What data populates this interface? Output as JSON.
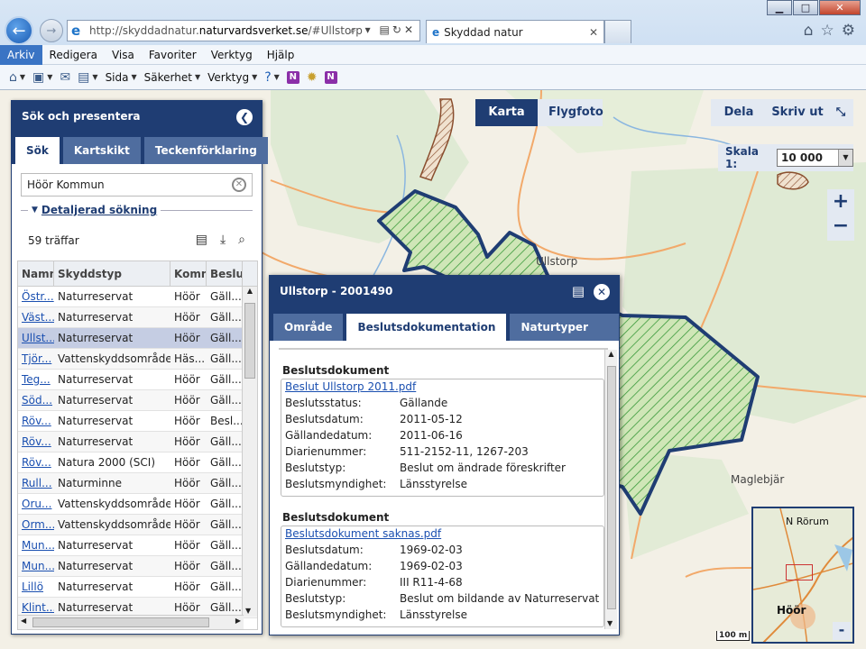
{
  "browser": {
    "url_prefix": "http://skyddadnatur.",
    "url_domain": "naturvardsverket.se",
    "url_suffix": "/#Ullstorp",
    "tab_title": "Skyddad natur",
    "menu": [
      "Arkiv",
      "Redigera",
      "Visa",
      "Favoriter",
      "Verktyg",
      "Hjälp"
    ],
    "commands": {
      "page": "Sida",
      "security": "Säkerhet",
      "tools": "Verktyg"
    }
  },
  "map": {
    "karta": "Karta",
    "flygfoto": "Flygfoto",
    "dela": "Dela",
    "skriv_ut": "Skriv ut",
    "scale_label": "Skala 1:",
    "scale_value": "10 000",
    "zoom_in": "+",
    "zoom_out": "−",
    "place_ullstorp": "Ullstorp",
    "place_maglebjar": "Maglebjär",
    "minimap_north": "N Rörum",
    "minimap_hoor": "Höör",
    "minimap_minus": "-",
    "scalebar": "100 m"
  },
  "panel": {
    "title": "Sök och presentera",
    "tabs": [
      "Sök",
      "Kartskikt",
      "Teckenförklaring"
    ],
    "search_value": "Höör Kommun",
    "advanced": "Detaljerad sökning",
    "hits": "59 träffar",
    "columns": [
      "Namn",
      "Skyddstyp",
      "Kommun",
      "Beslut"
    ],
    "rows": [
      [
        "Östr...",
        "Naturreservat",
        "Höör",
        "Gäll..."
      ],
      [
        "Väst...",
        "Naturreservat",
        "Höör",
        "Gäll..."
      ],
      [
        "Ullst...",
        "Naturreservat",
        "Höör",
        "Gäll..."
      ],
      [
        "Tjör...",
        "Vattenskyddsområde",
        "Häs...",
        "Gäll..."
      ],
      [
        "Teg...",
        "Naturreservat",
        "Höör",
        "Gäll..."
      ],
      [
        "Söd...",
        "Naturreservat",
        "Höör",
        "Gäll..."
      ],
      [
        "Röv...",
        "Naturreservat",
        "Höör",
        "Besl..."
      ],
      [
        "Röv...",
        "Naturreservat",
        "Höör",
        "Gäll..."
      ],
      [
        "Röv...",
        "Natura 2000 (SCI)",
        "Höör",
        "Gäll..."
      ],
      [
        "Rull...",
        "Naturminne",
        "Höör",
        "Gäll..."
      ],
      [
        "Oru...",
        "Vattenskyddsområde",
        "Höör",
        "Gäll..."
      ],
      [
        "Orm...",
        "Vattenskyddsområde",
        "Höör",
        "Gäll..."
      ],
      [
        "Mun...",
        "Naturreservat",
        "Höör",
        "Gäll..."
      ],
      [
        "Mun...",
        "Naturreservat",
        "Höör",
        "Gäll..."
      ],
      [
        "Lillö",
        "Naturreservat",
        "Höör",
        "Gäll..."
      ],
      [
        "Klint...",
        "Naturreservat",
        "Höör",
        "Gäll..."
      ]
    ],
    "selected_row": 2
  },
  "popup": {
    "title": "Ullstorp - 2001490",
    "tabs": [
      "Område",
      "Beslutsdokumentation",
      "Naturtyper (KNAS)"
    ],
    "docs": [
      {
        "heading": "Beslutsdokument",
        "link": "Beslut Ullstorp 2011.pdf",
        "fields": [
          [
            "Beslutsstatus:",
            "Gällande"
          ],
          [
            "Beslutsdatum:",
            "2011-05-12"
          ],
          [
            "Gällandedatum:",
            "2011-06-16"
          ],
          [
            "Diarienummer:",
            "511-2152-11, 1267-203"
          ],
          [
            "Beslutstyp:",
            "Beslut om ändrade föreskrifter"
          ],
          [
            "Beslutsmyndighet:",
            "Länsstyrelse"
          ]
        ]
      },
      {
        "heading": "Beslutsdokument",
        "link": "Beslutsdokument saknas.pdf",
        "fields": [
          [
            "Beslutsdatum:",
            "1969-02-03"
          ],
          [
            "Gällandedatum:",
            "1969-02-03"
          ],
          [
            "Diarienummer:",
            "III R11-4-68"
          ],
          [
            "Beslutstyp:",
            "Beslut om bildande av Naturreservat"
          ],
          [
            "Beslutsmyndighet:",
            "Länsstyrelse"
          ]
        ]
      }
    ]
  }
}
